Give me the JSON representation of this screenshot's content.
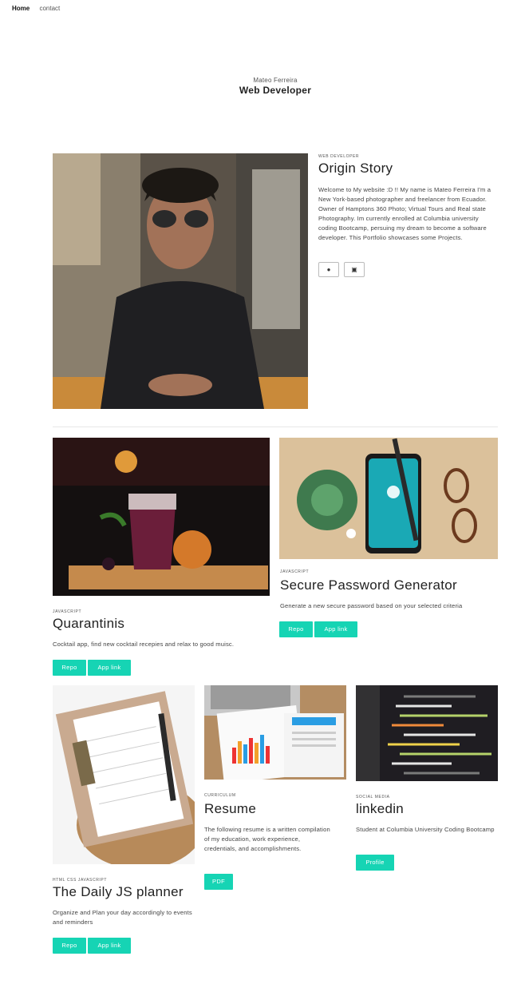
{
  "nav": {
    "home": "Home",
    "contact": "contact"
  },
  "hero": {
    "name": "Mateo Ferreira",
    "role": "Web Developer"
  },
  "about": {
    "eyebrow": "WEB DEVELOPER",
    "title": "Origin Story",
    "text": "Welcome to My website :D !! My name is Mateo Ferreira I'm a New York-based photographer and freelancer from Ecuador. Owner of Hamptons 360 Photo; Virtual Tours and Real state Photography. Im currently enrolled at Columbia university coding Bootcamp, persuing my dream to become a software developer. This Portfolio showcases some Projects.",
    "github_icon": "github-icon",
    "linkedin_icon": "linkedin-icon"
  },
  "projects": [
    {
      "eyebrow": "JAVASCRIPT",
      "title": "Quarantinis",
      "text": "Cocktail app, find new cocktail recepies and relax to good muisc.",
      "btn1": "Repo",
      "btn2": "App link"
    },
    {
      "eyebrow": "JAVASCRIPT",
      "title": "Secure Password Generator",
      "text": "Generate a new secure password based on your selected criteria",
      "btn1": "Repo",
      "btn2": "App link"
    },
    {
      "eyebrow": "HTML CSS JAVASCRIPT",
      "title": "The Daily JS planner",
      "text": "Organize and Plan your day accordingly to events and reminders",
      "btn1": "Repo",
      "btn2": "App link"
    },
    {
      "eyebrow": "CURRICULUM",
      "title": "Resume",
      "text": "The following resume is a written compilation of my education, work experience, credentials, and accomplishments.",
      "btn1": "PDF"
    },
    {
      "eyebrow": "SOCIAL MEDIA",
      "title": "linkedin",
      "text": "Student at Columbia University Coding Bootcamp",
      "btn1": "Profile"
    }
  ],
  "colors": {
    "accent": "#16d4b4"
  }
}
